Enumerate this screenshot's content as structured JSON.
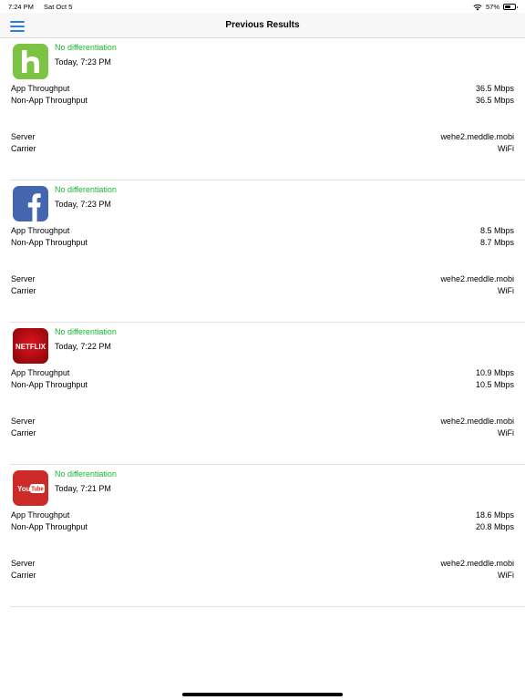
{
  "status_bar": {
    "time": "7:24 PM",
    "date": "Sat Oct 5",
    "battery_text": "57%",
    "battery_level": 0.57
  },
  "nav": {
    "title": "Previous Results"
  },
  "labels": {
    "app_throughput": "App Throughput",
    "non_app_throughput": "Non-App Throughput",
    "server": "Server",
    "carrier": "Carrier"
  },
  "results": [
    {
      "app": "Hulu",
      "icon": "hulu-icon",
      "status": "No differentiation",
      "time": "Today, 7:23 PM",
      "app_throughput": "36.5 Mbps",
      "non_app_throughput": "36.5 Mbps",
      "server": "wehe2.meddle.mobi",
      "carrier": "WiFi"
    },
    {
      "app": "Facebook",
      "icon": "facebook-icon",
      "status": "No differentiation",
      "time": "Today, 7:23 PM",
      "app_throughput": "8.5 Mbps",
      "non_app_throughput": "8.7 Mbps",
      "server": "wehe2.meddle.mobi",
      "carrier": "WiFi"
    },
    {
      "app": "Netflix",
      "icon": "netflix-icon",
      "icon_text": "NETFLIX",
      "status": "No differentiation",
      "time": "Today, 7:22 PM",
      "app_throughput": "10.9 Mbps",
      "non_app_throughput": "10.5 Mbps",
      "server": "wehe2.meddle.mobi",
      "carrier": "WiFi"
    },
    {
      "app": "YouTube",
      "icon": "youtube-icon",
      "icon_text": "YouTube",
      "status": "No differentiation",
      "time": "Today, 7:21 PM",
      "app_throughput": "18.6 Mbps",
      "non_app_throughput": "20.8 Mbps",
      "server": "wehe2.meddle.mobi",
      "carrier": "WiFi"
    }
  ],
  "colors": {
    "status_ok": "#16b92d",
    "accent": "#2f7fd8",
    "hulu": "#7cc243",
    "facebook": "#4466b0",
    "netflix": "#c30d14",
    "youtube": "#cd2a2a"
  }
}
